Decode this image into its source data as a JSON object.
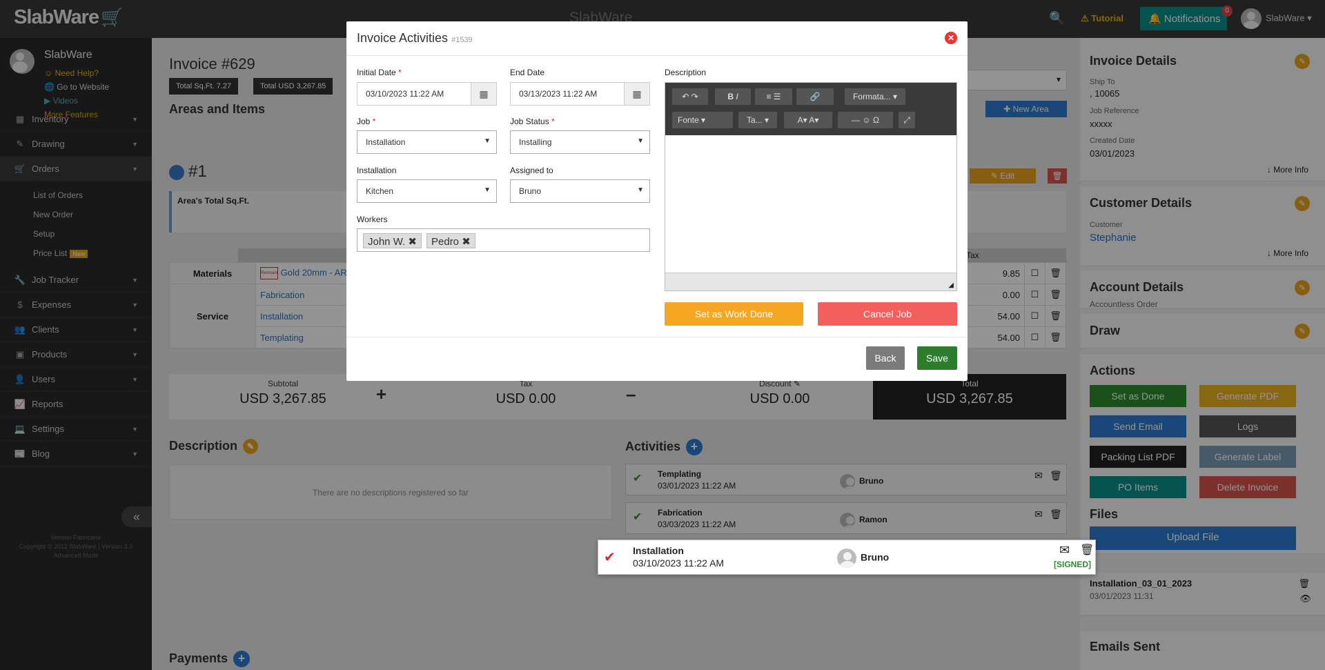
{
  "topbar": {
    "logo": "SlabWare",
    "center_title": "SlabWare",
    "tutorial": "Tutorial",
    "notifications": "Notifications",
    "notif_count": "0",
    "user": "SlabWare"
  },
  "sidebar": {
    "user_name": "SlabWare",
    "links": [
      "Need Help?",
      "Go to Website",
      "Videos",
      "More Features"
    ],
    "items": [
      {
        "label": "Inventory",
        "icon": "boxes-icon"
      },
      {
        "label": "Drawing",
        "icon": "pencil-icon"
      },
      {
        "label": "Orders",
        "icon": "cart-icon"
      },
      {
        "label": "Job Tracker",
        "icon": "wrench-icon"
      },
      {
        "label": "Expenses",
        "icon": "dollar-icon"
      },
      {
        "label": "Clients",
        "icon": "users-icon"
      },
      {
        "label": "Products",
        "icon": "box-icon"
      },
      {
        "label": "Users",
        "icon": "user-icon"
      },
      {
        "label": "Reports",
        "icon": "chart-icon"
      },
      {
        "label": "Settings",
        "icon": "laptop-icon"
      },
      {
        "label": "Blog",
        "icon": "newspaper-icon"
      }
    ],
    "orders_sub": [
      "List of Orders",
      "New Order",
      "Setup",
      "Price List"
    ],
    "new_badge": "New",
    "footer_lines": [
      "Version Fabricator",
      "Copyright © 2012 SlabWare | Version 3.0",
      "Advanced Mode"
    ]
  },
  "main": {
    "invoice_title": "Invoice #629",
    "chips": [
      "Total Sq.Ft. 7.27",
      "Total USD 3,267.85"
    ],
    "areas_title": "Areas and Items",
    "new_area": "New Area",
    "area_num": "#1",
    "edit": "Edit",
    "area_total": "Area's Total Sq.Ft.",
    "tax_head": "Tax",
    "materials_label": "Materials",
    "service_label": "Service",
    "material_item": "Gold 20mm - ART",
    "brand_mark": "Remnant",
    "services": [
      "Fabrication",
      "Installation",
      "Templating"
    ],
    "amount_col": [
      "9.85",
      "0.00",
      "54.00",
      "54.00"
    ],
    "totals": {
      "subtotal_label": "Subtotal",
      "subtotal": "USD 3,267.85",
      "tax_label": "Tax",
      "tax": "USD 0.00",
      "discount_label": "Discount",
      "discount": "USD 0.00",
      "total_label": "Total",
      "total": "USD 3,267.85"
    },
    "description_title": "Description",
    "no_desc": "There are no descriptions registered so far",
    "activities_title": "Activities",
    "activities": [
      {
        "name": "Templating",
        "date": "03/01/2023 11:22 AM",
        "user": "Bruno"
      },
      {
        "name": "Fabrication",
        "date": "03/03/2023 11:22 AM",
        "user": "Ramon"
      }
    ],
    "floating_activity": {
      "name": "Installation",
      "date": "03/10/2023 11:22 AM",
      "user": "Bruno",
      "status": "[SIGNED]"
    },
    "payments_title": "Payments"
  },
  "right": {
    "invoice_details": "Invoice Details",
    "ship_to_label": "Ship To",
    "ship_to": ", 10065",
    "job_ref_label": "Job Reference",
    "job_ref": "xxxxx",
    "created_label": "Created Date",
    "created": "03/01/2023",
    "more_info": "More Info",
    "customer_details": "Customer Details",
    "customer_label": "Customer",
    "customer": "Stephanie",
    "account_details": "Account Details",
    "account_val": "Accountless Order",
    "draw": "Draw",
    "actions": "Actions",
    "buttons": [
      "Set as Done",
      "Generate PDF",
      "Send Email",
      "Logs",
      "Packing List PDF",
      "Generate Label",
      "PO Items",
      "Delete Invoice"
    ],
    "files": "Files",
    "upload": "Upload File",
    "file_name": "Installation_03_01_2023",
    "file_date": "03/01/2023 11:31",
    "emails_sent": "Emails Sent"
  },
  "modal": {
    "title": "Invoice Activities",
    "id": "#1539",
    "initial_date_label": "Initial Date",
    "initial_date": "03/10/2023 11:22 AM",
    "end_date_label": "End Date",
    "end_date": "03/13/2023 11:22 AM",
    "job_label": "Job",
    "job": "Installation",
    "job_status_label": "Job Status",
    "job_status": "Installing",
    "installation_label": "Installation",
    "installation": "Kitchen",
    "assigned_label": "Assigned to",
    "assigned": "Bruno",
    "workers_label": "Workers",
    "workers": [
      "John W.",
      "Pedro"
    ],
    "description_label": "Description",
    "format_label": "Formata...",
    "font_label": "Fonte",
    "size_label": "Ta...",
    "work_done": "Set as Work Done",
    "cancel_job": "Cancel Job",
    "back": "Back",
    "save": "Save"
  },
  "colors": {
    "accent": "#2b7bd0",
    "warning": "#f5a623",
    "danger": "#f25f5c",
    "success": "#2e8b2e",
    "dark": "#222222"
  }
}
